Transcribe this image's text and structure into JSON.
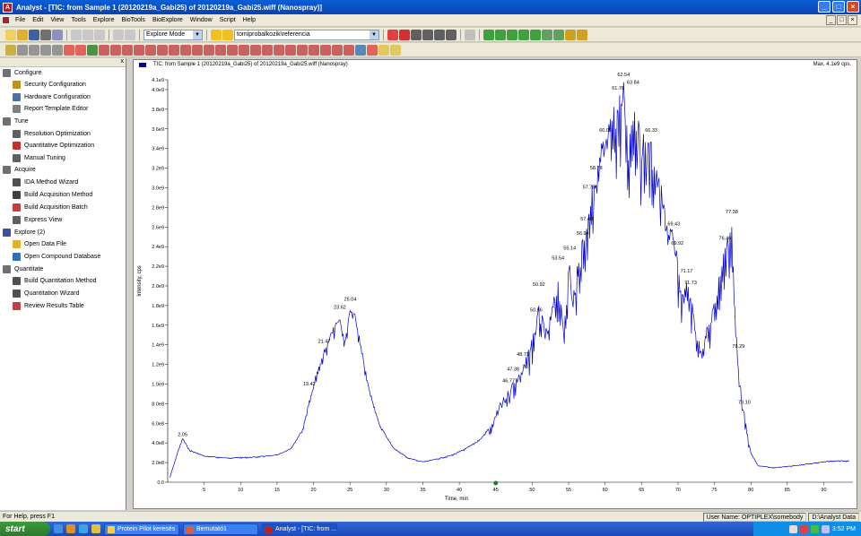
{
  "window": {
    "title": "Analyst - [TIC: from Sample 1 (20120219a_Gabi25) of 20120219a_Gabi25.wiff (Nanospray)]",
    "app_icon": "A",
    "minimize_glyph": "_",
    "maximize_glyph": "□",
    "close_glyph": "×"
  },
  "menu": [
    "File",
    "Edit",
    "View",
    "Tools",
    "Explore",
    "BioTools",
    "BioExplore",
    "Window",
    "Script",
    "Help"
  ],
  "toolbar": {
    "mode_select": "Explore Mode",
    "project_select": "tomiprobalkozik\\referencia",
    "combo_arrow": "▼"
  },
  "navigation": {
    "close_glyph": "x",
    "sections": [
      {
        "label": "Configure",
        "items": [
          "Security Configuration",
          "Hardware Configuration",
          "Report Template Editor"
        ]
      },
      {
        "label": "Tune",
        "items": [
          "Resolution Optimization",
          "Quantitative Optimization",
          "Manual Tuning"
        ]
      },
      {
        "label": "Acquire",
        "items": [
          "IDA Method Wizard",
          "Build Acquisition Method",
          "Build Acquisition Batch",
          "Express View"
        ]
      },
      {
        "label": "Explore  (2)",
        "items": [
          "Open Data File",
          "Open Compound Database"
        ]
      },
      {
        "label": "Quantitate",
        "items": [
          "Build Quantitation Method",
          "Quantitation Wizard",
          "Review Results Table"
        ]
      }
    ]
  },
  "plot_header": {
    "title": "TIC: from Sample 1 (20120219a_Gabi25) of 20120219a_Gabi25.wiff (Nanospray)",
    "max_label": "Max. 4.1e9 cps."
  },
  "chart_data": {
    "type": "line",
    "title": "TIC: from Sample 1 (20120219a_Gabi25) of 20120219a_Gabi25.wiff (Nanospray)",
    "xlabel": "Time, min",
    "ylabel": "Intensity, cps",
    "xlim": [
      0,
      94
    ],
    "ylim": [
      0,
      4100000000.0
    ],
    "x_ticks": [
      5,
      10,
      15,
      20,
      25,
      30,
      35,
      40,
      45,
      50,
      55,
      60,
      65,
      70,
      75,
      80,
      85,
      90
    ],
    "y_ticks": [
      {
        "value": 0,
        "label": "0.0"
      },
      {
        "value": 200000000.0,
        "label": "2.0e8"
      },
      {
        "value": 400000000.0,
        "label": "4.0e8"
      },
      {
        "value": 600000000.0,
        "label": "6.0e8"
      },
      {
        "value": 800000000.0,
        "label": "8.0e8"
      },
      {
        "value": 1000000000.0,
        "label": "1.0e9"
      },
      {
        "value": 1200000000.0,
        "label": "1.2e9"
      },
      {
        "value": 1400000000.0,
        "label": "1.4e9"
      },
      {
        "value": 1600000000.0,
        "label": "1.6e9"
      },
      {
        "value": 1800000000.0,
        "label": "1.8e9"
      },
      {
        "value": 2000000000.0,
        "label": "2.0e9"
      },
      {
        "value": 2200000000.0,
        "label": "2.2e9"
      },
      {
        "value": 2400000000.0,
        "label": "2.4e9"
      },
      {
        "value": 2600000000.0,
        "label": "2.6e9"
      },
      {
        "value": 2800000000.0,
        "label": "2.8e9"
      },
      {
        "value": 3000000000.0,
        "label": "3.0e9"
      },
      {
        "value": 3200000000.0,
        "label": "3.2e9"
      },
      {
        "value": 3400000000.0,
        "label": "3.4e9"
      },
      {
        "value": 3600000000.0,
        "label": "3.6e9"
      },
      {
        "value": 3800000000.0,
        "label": "3.8e9"
      },
      {
        "value": 4000000000.0,
        "label": "4.0e9"
      },
      {
        "value": 4100000000.0,
        "label": "4.1e9"
      }
    ],
    "color": "#0000cc",
    "series": [
      {
        "x": [
          0.3,
          1.5,
          2.05,
          3,
          5,
          8,
          12,
          15,
          17,
          18.5,
          19.42,
          20.5,
          21.47,
          22.5,
          23.62,
          24.3,
          25.04,
          25.8,
          26.5,
          27.5,
          29,
          31,
          33,
          35,
          37,
          39,
          41,
          43,
          44.5,
          45.5,
          46.77,
          47.38,
          48.73,
          49.5,
          50.56,
          50.92,
          52,
          53.54,
          54.3,
          55.14,
          55.5,
          56.94,
          57.48,
          57.78,
          58.78,
          59.5,
          60.06,
          61.2,
          61.78,
          62.54,
          63.2,
          63.84,
          64.8,
          65.5,
          66.33,
          67.5,
          68.5,
          69.43,
          69.92,
          70.6,
          71.17,
          71.73,
          73,
          74.5,
          76.46,
          77.38,
          77.8,
          78.29,
          78.8,
          79.1,
          80,
          81,
          83,
          86,
          89,
          91,
          93.5
        ],
        "y": [
          50000000.0,
          340000000.0,
          450000000.0,
          330000000.0,
          270000000.0,
          250000000.0,
          260000000.0,
          280000000.0,
          350000000.0,
          550000000.0,
          850000000.0,
          1150000000.0,
          1350000000.0,
          1550000000.0,
          1700000000.0,
          1450000000.0,
          1780000000.0,
          1700000000.0,
          1400000000.0,
          1000000000.0,
          600000000.0,
          350000000.0,
          250000000.0,
          210000000.0,
          240000000.0,
          280000000.0,
          350000000.0,
          450000000.0,
          600000000.0,
          800000000.0,
          950000000.0,
          1050000000.0,
          1200000000.0,
          1350000000.0,
          1680000000.0,
          1800000000.0,
          1550000000.0,
          2100000000.0,
          1600000000.0,
          2350000000.0,
          1900000000.0,
          2550000000.0,
          2650000000.0,
          2950000000.0,
          3150000000.0,
          3500000000.0,
          3550000000.0,
          3850000000.0,
          3950000000.0,
          4100000000.0,
          3500000000.0,
          4000000000.0,
          3600000000.0,
          3550000000.0,
          3500000000.0,
          3100000000.0,
          2750000000.0,
          2550000000.0,
          2300000000.0,
          1950000000.0,
          2050000000.0,
          1950000000.0,
          1400000000.0,
          1700000000.0,
          2450000000.0,
          2700000000.0,
          1800000000.0,
          1250000000.0,
          800000000.0,
          700000000.0,
          300000000.0,
          170000000.0,
          150000000.0,
          170000000.0,
          200000000.0,
          220000000.0,
          220000000.0
        ]
      }
    ],
    "peak_labels": [
      {
        "x": 2.05,
        "y": 450000000.0,
        "label": "2.05"
      },
      {
        "x": 19.42,
        "y": 970000000.0,
        "label": "19.42"
      },
      {
        "x": 21.47,
        "y": 1400000000.0,
        "label": "21.47"
      },
      {
        "x": 23.62,
        "y": 1750000000.0,
        "label": "23.62"
      },
      {
        "x": 25.04,
        "y": 1830000000.0,
        "label": "25.04"
      },
      {
        "x": 46.77,
        "y": 1000000000.0,
        "label": "46.77"
      },
      {
        "x": 47.38,
        "y": 1120000000.0,
        "label": "47.38"
      },
      {
        "x": 48.73,
        "y": 1270000000.0,
        "label": "48.73"
      },
      {
        "x": 50.56,
        "y": 1720000000.0,
        "label": "50.56"
      },
      {
        "x": 50.92,
        "y": 1980000000.0,
        "label": "50.92"
      },
      {
        "x": 53.54,
        "y": 2250000000.0,
        "label": "53.54"
      },
      {
        "x": 55.14,
        "y": 2350000000.0,
        "label": "55.14"
      },
      {
        "x": 56.94,
        "y": 2500000000.0,
        "label": "56.94"
      },
      {
        "x": 57.48,
        "y": 2650000000.0,
        "label": "57.48"
      },
      {
        "x": 57.78,
        "y": 2970000000.0,
        "label": "57.78"
      },
      {
        "x": 58.78,
        "y": 3170000000.0,
        "label": "58.78"
      },
      {
        "x": 60.06,
        "y": 3550000000.0,
        "label": "60.06"
      },
      {
        "x": 61.78,
        "y": 3980000000.0,
        "label": "61.78"
      },
      {
        "x": 62.54,
        "y": 4120000000.0,
        "label": "62.54"
      },
      {
        "x": 63.84,
        "y": 4040000000.0,
        "label": "63.84"
      },
      {
        "x": 66.33,
        "y": 3550000000.0,
        "label": "66.33"
      },
      {
        "x": 69.43,
        "y": 2600000000.0,
        "label": "69.43"
      },
      {
        "x": 69.92,
        "y": 2400000000.0,
        "label": "69.92"
      },
      {
        "x": 71.17,
        "y": 2120000000.0,
        "label": "71.17"
      },
      {
        "x": 71.73,
        "y": 2000000000.0,
        "label": "71.73"
      },
      {
        "x": 76.46,
        "y": 2450000000.0,
        "label": "76.46"
      },
      {
        "x": 77.38,
        "y": 2720000000.0,
        "label": "77.38"
      },
      {
        "x": 78.29,
        "y": 1350000000.0,
        "label": "78.29"
      },
      {
        "x": 79.1,
        "y": 780000000.0,
        "label": "79.10"
      }
    ]
  },
  "status": {
    "help": "For Help, press F1",
    "user": "User Name: OPTIPLEX\\somebody",
    "path": "D:\\Analyst Data"
  },
  "taskbar": {
    "start": "start",
    "tasks": [
      "Protein Pilot keresés",
      "Bemutató1",
      "Analyst - [TIC: from ..."
    ],
    "clock": "3:52 PM"
  },
  "colors": {
    "titlebar": "#0842b0",
    "trace": "#0000cc",
    "taskbar": "#1d48b8",
    "start": "#2a7a2a"
  }
}
